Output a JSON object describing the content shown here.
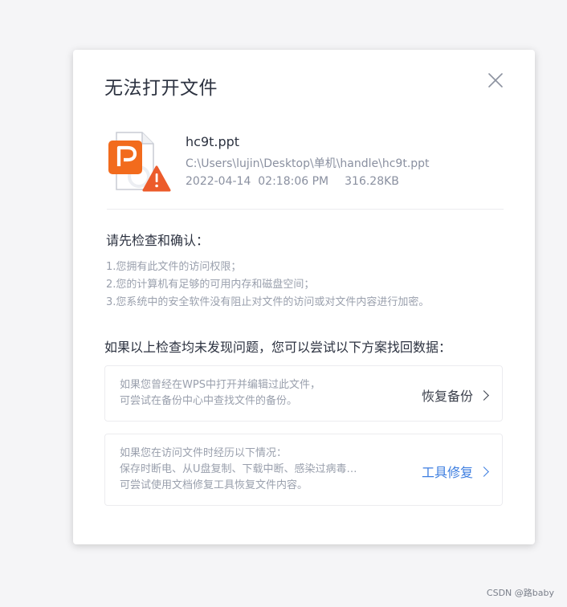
{
  "dialog": {
    "title": "无法打开文件",
    "close_icon": "close-icon"
  },
  "file": {
    "icon": "ppt-file-warning-icon",
    "name": "hc9t.ppt",
    "path": "C:\\Users\\lujin\\Desktop\\单机\\handle\\hc9t.ppt",
    "datetime": "2022-04-14  02:18:06 PM",
    "size": "316.28KB",
    "colors": {
      "brand": "#f26b1d",
      "warning": "#ec5b2b"
    }
  },
  "checks": {
    "heading": "请先检查和确认：",
    "items": [
      "1.您拥有此文件的访问权限；",
      "2.您的计算机有足够的可用内存和磁盘空间；",
      "3.您系统中的安全软件没有阻止对文件的访问或对文件内容进行加密。"
    ]
  },
  "solutions": {
    "heading": "如果以上检查均未发现问题，您可以尝试以下方案找回数据：",
    "backup": {
      "lines": [
        "如果您曾经在WPS中打开并编辑过此文件，",
        "可尝试在备份中心中查找文件的备份。"
      ],
      "action_label": "恢复备份"
    },
    "repair": {
      "lines": [
        "如果您在访问文件时经历以下情况：",
        "保存时断电、从U盘复制、下载中断、感染过病毒…",
        "可尝试使用文档修复工具恢复文件内容。"
      ],
      "action_label": "工具修复",
      "action_color": "#3d7ee0"
    }
  },
  "watermark": "CSDN @路baby"
}
